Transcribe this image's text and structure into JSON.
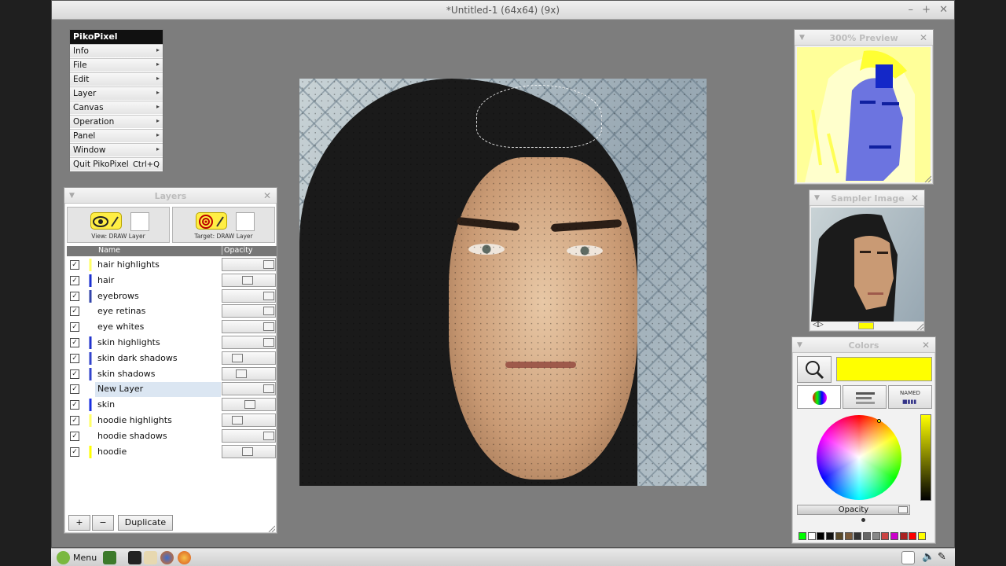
{
  "window": {
    "title": "*Untitled-1 (64x64) (9x)",
    "controls": [
      "–",
      "+",
      "✕"
    ]
  },
  "menu": {
    "title": "PikoPixel",
    "items": [
      "Info",
      "File",
      "Edit",
      "Layer",
      "Canvas",
      "Operation",
      "Panel",
      "Window"
    ],
    "quit_label": "Quit PikoPixel",
    "quit_shortcut": "Ctrl+Q",
    "submenu_arrow": "▸"
  },
  "layers_panel": {
    "title": "Layers",
    "view_label": "View: DRAW Layer",
    "target_label": "Target: DRAW Layer",
    "col_name": "Name",
    "col_opacity": "Opacity",
    "layers": [
      {
        "name": "hair highlights",
        "opacity": 1.0,
        "thumb": "#ffff66"
      },
      {
        "name": "hair",
        "opacity": 0.45,
        "thumb": "#1a2fd0"
      },
      {
        "name": "eyebrows",
        "opacity": 1.0,
        "thumb": "#3344aa"
      },
      {
        "name": "eye retinas",
        "opacity": 1.0,
        "thumb": "#ffffff"
      },
      {
        "name": "eye whites",
        "opacity": 1.0,
        "thumb": "#ffffff"
      },
      {
        "name": "skin highlights",
        "opacity": 1.0,
        "thumb": "#2233cc"
      },
      {
        "name": "skin dark shadows",
        "opacity": 0.2,
        "thumb": "#3344cc"
      },
      {
        "name": "skin shadows",
        "opacity": 0.3,
        "thumb": "#3344cc"
      },
      {
        "name": "New Layer",
        "opacity": 1.0,
        "thumb": "#ffffff",
        "selected": true
      },
      {
        "name": "skin",
        "opacity": 0.52,
        "thumb": "#1a2fe0"
      },
      {
        "name": "hoodie highlights",
        "opacity": 0.2,
        "thumb": "#ffff66"
      },
      {
        "name": "hoodie shadows",
        "opacity": 1.0,
        "thumb": "#ffffff"
      },
      {
        "name": "hoodie",
        "opacity": 0.45,
        "thumb": "#ffff00"
      }
    ],
    "add_label": "+",
    "remove_label": "−",
    "duplicate_label": "Duplicate"
  },
  "preview_panel": {
    "title": "300% Preview"
  },
  "sampler_panel": {
    "title": "Sampler Image"
  },
  "colors_panel": {
    "title": "Colors",
    "current_color": "#ffff00",
    "named_label": "NAMED",
    "opacity_label": "Opacity",
    "palette": [
      "#00ff00",
      "#ffffff",
      "#000000",
      "#111111",
      "#5a4a2a",
      "#7a5a3a",
      "#333333",
      "#666666",
      "#888888",
      "#cc4444",
      "#cc00cc",
      "#aa2222",
      "#ff0000",
      "#ffff00"
    ]
  },
  "taskbar": {
    "menu_label": "Menu"
  }
}
